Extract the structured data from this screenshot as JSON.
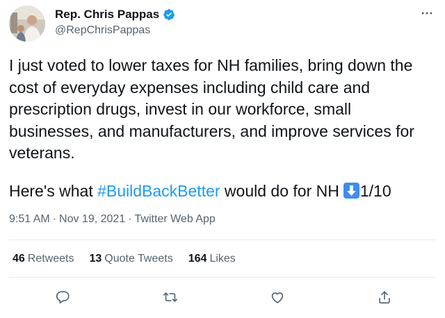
{
  "tweet": {
    "author": {
      "display_name": "Rep. Chris Pappas",
      "handle": "@RepChrisPappas",
      "verified": true,
      "avatar_icon": "profile-photo"
    },
    "text_paragraph_1": "I just voted to lower taxes for NH families, bring down the cost of everyday expenses including child care and prescription drugs, invest in our workforce, small businesses, and manufacturers, and improve services for veterans.",
    "text_paragraph_2": {
      "prefix": "Here's what ",
      "hashtag": "#BuildBackBetter",
      "suffix": " would do for NH",
      "emoji": "down-arrow-emoji",
      "thread_count": "1/10"
    },
    "timestamp": "9:51 AM",
    "date": "Nov 19, 2021",
    "separator": "·",
    "source": "Twitter Web App",
    "stats": {
      "retweets_count": "46",
      "retweets_label": "Retweets",
      "quotes_count": "13",
      "quotes_label": "Quote Tweets",
      "likes_count": "164",
      "likes_label": "Likes"
    },
    "actions": [
      "reply-icon",
      "retweet-icon",
      "like-icon",
      "share-icon"
    ]
  },
  "colors": {
    "text": "#0f1419",
    "secondary": "#536471",
    "accent": "#1d9bf0",
    "divider": "#e6ecf0"
  }
}
